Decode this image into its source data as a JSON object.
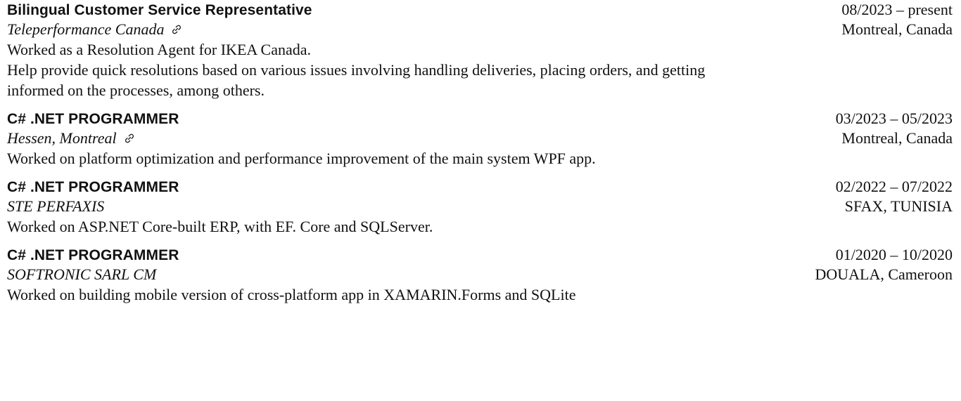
{
  "experience": [
    {
      "title": "Bilingual Customer Service Representative",
      "dates": "08/2023 – present",
      "company": "Teleperformance Canada",
      "has_link": true,
      "location": "Montreal, Canada",
      "description": [
        "Worked as a Resolution Agent for IKEA Canada.",
        "Help provide quick resolutions based on various issues involving handling deliveries, placing orders, and getting informed on the processes, among others."
      ]
    },
    {
      "title": "C# .NET PROGRAMMER",
      "dates": "03/2023 – 05/2023",
      "company": "Hessen, Montreal",
      "has_link": true,
      "location": "Montreal, Canada",
      "description": [
        "Worked on platform optimization and performance improvement of the main system WPF app."
      ]
    },
    {
      "title": "C# .NET PROGRAMMER",
      "dates": "02/2022 – 07/2022",
      "company": "STE PERFAXIS",
      "has_link": false,
      "location": "SFAX, TUNISIA",
      "description": [
        "Worked on ASP.NET Core-built ERP, with EF. Core and SQLServer."
      ]
    },
    {
      "title": "C# .NET PROGRAMMER",
      "dates": "01/2020 – 10/2020",
      "company": "SOFTRONIC SARL CM",
      "has_link": false,
      "location": "DOUALA, Cameroon",
      "description": [
        "Worked on building mobile version of cross-platform app in XAMARIN.Forms and SQLite"
      ]
    }
  ],
  "icons": {
    "company_link": "link-icon"
  }
}
